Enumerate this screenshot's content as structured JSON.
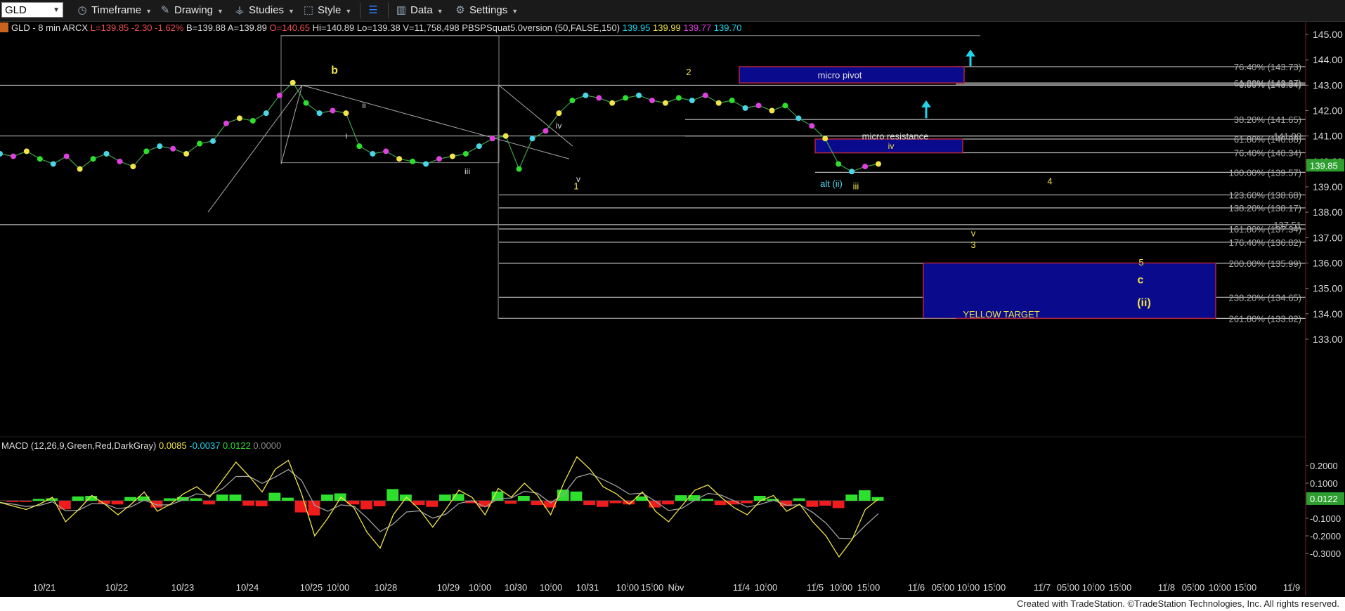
{
  "toolbar": {
    "symbol": "GLD",
    "timeframe": "Timeframe",
    "drawing": "Drawing",
    "studies": "Studies",
    "style": "Style",
    "data": "Data",
    "settings": "Settings"
  },
  "header": {
    "symbol_info": "GLD - 8 min  ARCX",
    "last": "L=139.85",
    "change": "-2.30",
    "change_pct": "-1.62%",
    "bid": "B=139.88",
    "ask": "A=139.89",
    "open": "O=140.65",
    "high": "Hi=140.89",
    "low": "Lo=139.38",
    "volume": "V=11,758,498",
    "study": "PBSPSquat5.0version (50,FALSE,150)",
    "study_values": [
      "139.95",
      "139.99",
      "139.77",
      "139.70"
    ]
  },
  "macd": {
    "label": "MACD (12,26,9,Green,Red,DarkGray)",
    "values": [
      "0.0085",
      "-0.0037",
      "0.0122",
      "0.0000"
    ],
    "current": "0.0122",
    "axis": [
      "0.2000",
      "0.1000",
      "-0.1000",
      "-0.2000",
      "-0.3000"
    ]
  },
  "footer": "Created with TradeStation. ©TradeStation Technologies, Inc. All rights reserved.",
  "colors": {
    "fib": "#b7b7b7",
    "box": "#0a0a8c",
    "box_border": "#b0243c",
    "label_yellow": "#f0e24a",
    "label_cyan": "#4ad6e8",
    "arrow": "#20d4ea",
    "price_tag": "#2e9f2e",
    "macd_up": "#2ee02e",
    "macd_down": "#ee1c1c",
    "macd_line": "#f2e54a",
    "macd_signal": "#a0a0a0"
  },
  "chart_data": {
    "type": "candlestick",
    "symbol": "GLD",
    "interval": "8 min",
    "last_price": "139.85",
    "y_axis": [
      "145.00",
      "144.00",
      "143.00",
      "142.00",
      "141.00",
      "140.00",
      "139.00",
      "138.00",
      "137.00",
      "136.00",
      "135.00",
      "134.00",
      "133.00"
    ],
    "ylim": [
      132.6,
      145.1
    ],
    "x_axis": [
      "10/21",
      "10/22",
      "10/23",
      "10/24",
      "10/25",
      "10:00",
      "10/28",
      "10/29",
      "10:00",
      "10/30",
      "10:00",
      "10/31",
      "10:00",
      "15:00",
      "Nov",
      "11/4",
      "10:00",
      "11/5",
      "10:00",
      "15:00",
      "11/6",
      "05:00",
      "10:00",
      "15:00",
      "11/7",
      "05:00",
      "10:00",
      "15:00",
      "11/8",
      "05:00",
      "10:00",
      "15:00",
      "11/9"
    ],
    "fib_levels": [
      {
        "label": "76.40% (143.73)",
        "price": 143.73
      },
      {
        "label": "61.80% (143.37)",
        "price": 143.09
      },
      {
        "label": "0.00% (143.04)",
        "price": 143.04
      },
      {
        "label": "38.20% (141.65)",
        "price": 141.65
      },
      {
        "label": "141.00",
        "price": 141.0
      },
      {
        "label": "61.80% (140.88)",
        "price": 140.88
      },
      {
        "label": "76.40% (140.34)",
        "price": 140.34
      },
      {
        "label": "100.00% (139.57)",
        "price": 139.57
      },
      {
        "label": "123.60% (138.68)",
        "price": 138.68
      },
      {
        "label": "138.20% (138.17)",
        "price": 138.17
      },
      {
        "label": "137.51",
        "price": 137.51
      },
      {
        "label": "161.80% (137.34)",
        "price": 137.34
      },
      {
        "label": "176.40% (136.82)",
        "price": 136.82
      },
      {
        "label": "200.00% (135.99)",
        "price": 135.99
      },
      {
        "label": "238.20% (134.65)",
        "price": 134.65
      },
      {
        "label": "261.80% (133.82)",
        "price": 133.82
      }
    ],
    "boxes": [
      {
        "label": "micro pivot",
        "top": 143.73,
        "bottom": 143.09
      },
      {
        "label": "micro resistance",
        "top": 140.88,
        "bottom": 140.34
      },
      {
        "label": "YELLOW TARGET",
        "top": 136.0,
        "bottom": 133.82
      }
    ],
    "wave_labels_yellow": [
      "b",
      "2",
      "1",
      "4",
      "v",
      "3",
      "5",
      "c",
      "(ii)",
      "iii"
    ],
    "wave_labels_white": [
      "ii",
      "i",
      "iii",
      "iv",
      "v",
      "iv"
    ],
    "wave_labels_cyan": [
      "alt (ii)"
    ],
    "price_series": [
      140.3,
      140.2,
      140.4,
      140.1,
      139.9,
      140.2,
      139.7,
      140.1,
      140.3,
      140.0,
      139.8,
      140.4,
      140.6,
      140.5,
      140.3,
      140.7,
      140.8,
      141.5,
      141.7,
      141.6,
      141.9,
      142.6,
      143.1,
      142.3,
      141.9,
      142.0,
      141.9,
      140.6,
      140.3,
      140.4,
      140.1,
      140.0,
      139.9,
      140.1,
      140.2,
      140.3,
      140.6,
      140.9,
      141.0,
      139.7,
      140.9,
      141.2,
      141.9,
      142.4,
      142.6,
      142.5,
      142.3,
      142.5,
      142.6,
      142.4,
      142.3,
      142.5,
      142.4,
      142.6,
      142.3,
      142.4,
      142.1,
      142.2,
      142.0,
      142.2,
      141.7,
      141.4,
      140.9,
      139.9,
      139.6,
      139.8,
      139.9
    ],
    "macd_series": [
      -0.01,
      -0.03,
      -0.05,
      -0.02,
      0.02,
      -0.12,
      -0.05,
      0.03,
      -0.02,
      -0.08,
      -0.02,
      0.05,
      -0.06,
      -0.02,
      0.04,
      0.08,
      0.02,
      0.12,
      0.22,
      0.14,
      0.05,
      0.18,
      0.23,
      0.04,
      -0.2,
      -0.1,
      0.02,
      -0.04,
      -0.18,
      -0.27,
      -0.08,
      0.02,
      -0.05,
      -0.15,
      -0.05,
      0.06,
      0.02,
      -0.08,
      0.07,
      0.02,
      0.1,
      0.03,
      -0.08,
      0.1,
      0.25,
      0.18,
      0.08,
      0.04,
      -0.02,
      0.05,
      -0.06,
      -0.12,
      -0.03,
      0.06,
      0.09,
      0.02,
      -0.04,
      -0.08,
      0.0,
      0.03,
      -0.06,
      -0.02,
      -0.12,
      -0.2,
      -0.32,
      -0.22,
      -0.05,
      0.01
    ]
  }
}
